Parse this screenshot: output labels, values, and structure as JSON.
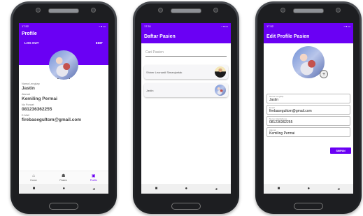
{
  "phone1": {
    "time": "17.52",
    "status_icons": "◔ ▾ ▭",
    "title": "Profile",
    "logout_label": "LOG OUT",
    "edit_label": "EDIT",
    "display_name": "Jastin",
    "fields": [
      {
        "label": "Nama Lengkap",
        "value": "Jastin"
      },
      {
        "label": "Alamat",
        "value": "Kemiling Permai"
      },
      {
        "label": "No Ponsel",
        "value": "081236362255"
      },
      {
        "label": "E-Mail",
        "value": "firebasegultom@gmail.com"
      }
    ],
    "bottom_nav": [
      {
        "icon": "⌂",
        "label": "Home"
      },
      {
        "icon": "☗",
        "label": "Pasien"
      },
      {
        "icon": "▣",
        "label": "Profile"
      }
    ]
  },
  "phone2": {
    "time": "17.51",
    "status_icons": "◔ ▾ ▭",
    "title": "Daftar Pasien",
    "search_placeholder": "Cari Pasien",
    "patients": [
      {
        "name": "Shiner Leonardi Simanjuntak"
      },
      {
        "name": "Jastin"
      }
    ]
  },
  "phone3": {
    "time": "17.52",
    "status_icons": "◔ ▾ ▭",
    "title": "Edit Profile Pasien",
    "fields": [
      {
        "label": "Nama Lengkap",
        "value": "Jastin"
      },
      {
        "label": "Email",
        "value": "firebasegultom@gmail.com"
      },
      {
        "label": "Nomor Handphone",
        "value": "081236362255"
      },
      {
        "label": "Alamat",
        "value": "Kemiling Permai"
      }
    ],
    "save_label": "SIMPAN"
  },
  "system_nav": {
    "recent": "■",
    "home": "●",
    "back": "◂"
  },
  "colors": {
    "accent": "#6a00f4"
  }
}
